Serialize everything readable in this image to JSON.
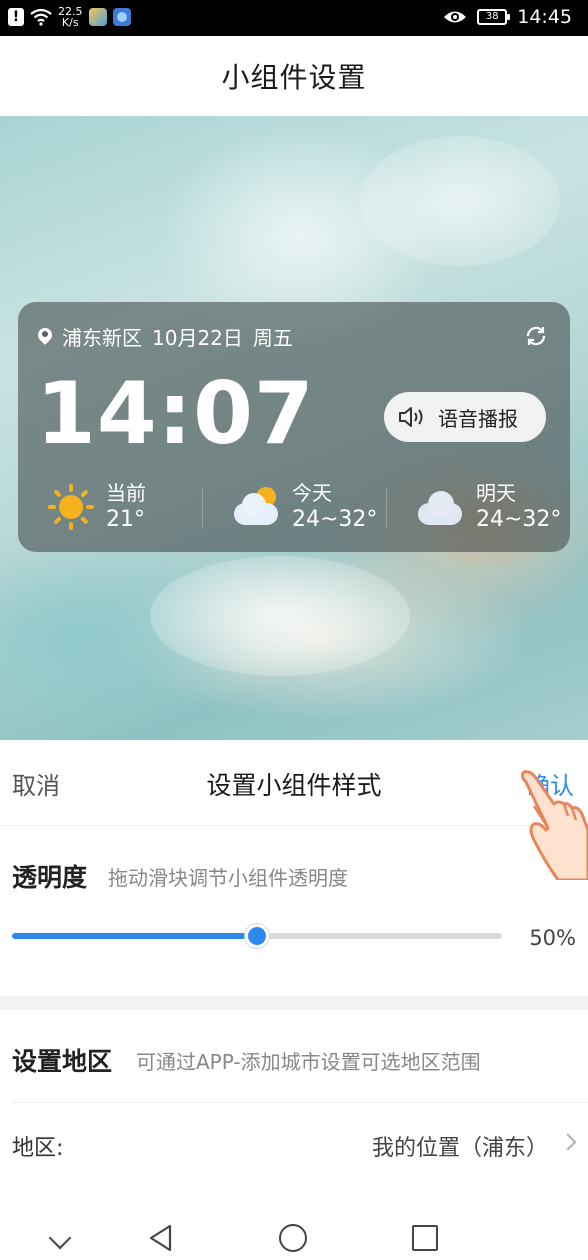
{
  "status_bar": {
    "net_speed": "22.5",
    "net_unit": "K/s",
    "battery": "38",
    "time": "14:45"
  },
  "page": {
    "title": "小组件设置"
  },
  "widget": {
    "location": "浦东新区",
    "date": "10月22日",
    "weekday": "周五",
    "time": "14:07",
    "voice_button": "语音播报",
    "weather": [
      {
        "label": "当前",
        "temp": "21°",
        "icon": "sun-icon"
      },
      {
        "label": "今天",
        "temp": "24~32°",
        "icon": "sun-cloud-icon"
      },
      {
        "label": "明天",
        "temp": "24~32°",
        "icon": "cloud-icon"
      }
    ]
  },
  "style_panel": {
    "cancel": "取消",
    "title": "设置小组件样式",
    "confirm": "确认",
    "opacity_label": "透明度",
    "opacity_hint": "拖动滑块调节小组件透明度",
    "opacity_value": 0.5,
    "opacity_text": "50%",
    "region_label": "设置地区",
    "region_hint": "可通过APP-添加城市设置可选地区范围",
    "area_label": "地区:",
    "area_value": "我的位置（浦东）"
  },
  "colors": {
    "accent": "#2f88ee",
    "widget_bg": "rgba(72,80,82,0.62)",
    "sun": "#f5b21c"
  }
}
